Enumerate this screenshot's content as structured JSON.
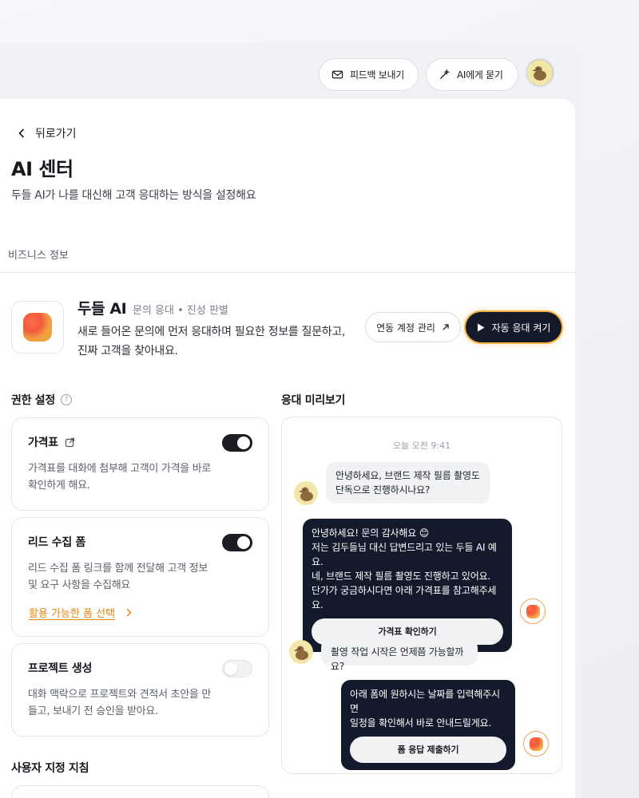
{
  "topbar": {
    "feedback_label": "피드백 보내기",
    "ask_ai_label": "AI에게 묻기"
  },
  "header": {
    "back_label": "뒤로가기",
    "title": "AI 센터",
    "subtitle": "두들 AI가 나를 대신해 고객 응대하는 방식을 설정해요"
  },
  "section_tab": "비즈니스 정보",
  "ai_profile": {
    "name": "두들 AI",
    "tags": "문의 응대 • 진성 판별",
    "description": "새로 들어온 문의에 먼저 응대하며 필요한 정보를 질문하고, 진짜 고객을 찾아내요.",
    "manage_accounts_label": "연동 계정 관리",
    "auto_reply_label": "자동 응대 켜기"
  },
  "permissions": {
    "heading": "권한 설정",
    "cards": [
      {
        "title": "가격표",
        "description": "가격표를 대화에 첨부해 고객이 가격을 바로 확인하게 해요.",
        "enabled": true
      },
      {
        "title": "리드 수집 폼",
        "description": "리드 수집 폼 링크를 함께 전달해 고객 정보 및 요구 사항을 수집해요",
        "enabled": true,
        "link_label": "활용 가능한 폼 선택"
      },
      {
        "title": "프로젝트 생성",
        "description": "대화 맥락으로 프로젝트와 견적서 초안을 만들고, 보내기 전 승인을 받아요.",
        "enabled": false
      }
    ],
    "custom_guidelines_heading": "사용자 지정 지침"
  },
  "preview": {
    "heading": "응대 미리보기",
    "timestamp": "오늘 오전 9:41",
    "messages": [
      {
        "from": "customer",
        "line1": "안녕하세요, 브랜드 제작 필름 촬영도",
        "line2": "단독으로 진행하시나요?"
      },
      {
        "from": "ai",
        "line1": "안녕하세요! 문의 감사해요 😊",
        "line2": "저는 김두들님 대신 답변드리고 있는 두들 AI 예요.",
        "line3": "네, 브랜드 제작 필름 촬영도 진행하고 있어요.",
        "line4": "단가가 궁금하시다면 아래 가격표를 참고해주세요.",
        "button": "가격표 확인하기"
      },
      {
        "from": "customer",
        "line1": "촬영 작업 시작은 언제쯤 가능할까요?"
      },
      {
        "from": "ai",
        "line1": "아래 폼에 원하시는 날짜를 입력해주시면",
        "line2": "일정을 확인해서 바로 안내드릴게요.",
        "button": "폼 응답 제출하기"
      }
    ]
  },
  "colors": {
    "primary_dark": "#151a2a",
    "accent_orange": "#e8870f",
    "glow": "#f6b143"
  }
}
